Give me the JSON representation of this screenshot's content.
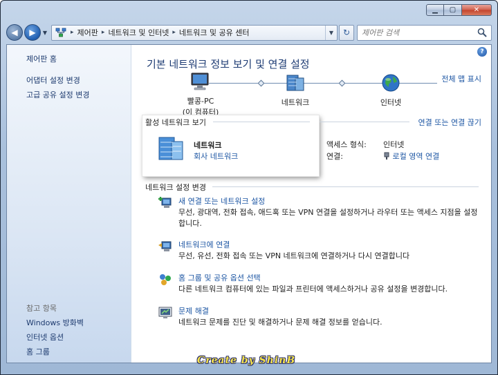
{
  "window": {
    "caption_buttons": {
      "minimize": "▁",
      "maximize": "▢",
      "close": "✕"
    }
  },
  "navbar": {
    "breadcrumbs": [
      "제어판",
      "네트워크 및 인터넷",
      "네트워크 및 공유 센터"
    ],
    "search_placeholder": "제어판 검색"
  },
  "sidebar": {
    "items": [
      "제어판 홈",
      "어댑터 설정 변경",
      "고급 공유 설정 변경"
    ],
    "see_also_header": "참고 항목",
    "see_also": [
      "Windows 방화벽",
      "인터넷 옵션",
      "홈 그룹"
    ]
  },
  "main": {
    "title": "기본 네트워크 정보 보기 및 연결 설정",
    "full_map_link": "전체 맵 표시",
    "map": {
      "computer_name": "빨콩-PC",
      "computer_sub": "(이 컴퓨터)",
      "network": "네트워크",
      "internet": "인터넷"
    },
    "active_networks": {
      "header": "활성 네트워크 보기",
      "disconnect_link": "연결 또는 연결 끊기",
      "network_name": "네트워크",
      "network_type": "회사 네트워크",
      "access_type_label": "액세스 형식:",
      "access_type_value": "인터넷",
      "connections_label": "연결:",
      "connections_value": "로컬 영역 연결"
    },
    "settings": {
      "header": "네트워크 설정 변경",
      "tasks": [
        {
          "title": "새 연결 또는 네트워크 설정",
          "desc": "무선, 광대역, 전화 접속, 애드혹 또는 VPN 연결을 설정하거나 라우터 또는 액세스 지점을 설정합니다."
        },
        {
          "title": "네트워크에 연결",
          "desc": "무선, 유선, 전화 접속 또는 VPN 네트워크에 연결하거나 다시 연결합니다"
        },
        {
          "title": "홈 그룹 및 공유 옵션 선택",
          "desc": "다른 네트워크 컴퓨터에 있는 파일과 프린터에 액세스하거나 공유 설정을 변경합니다."
        },
        {
          "title": "문제 해결",
          "desc": "네트워크 문제를 진단 및 해결하거나 문제 해결 정보를 얻습니다."
        }
      ]
    },
    "help": "?"
  },
  "watermark": "Create by ShinB"
}
